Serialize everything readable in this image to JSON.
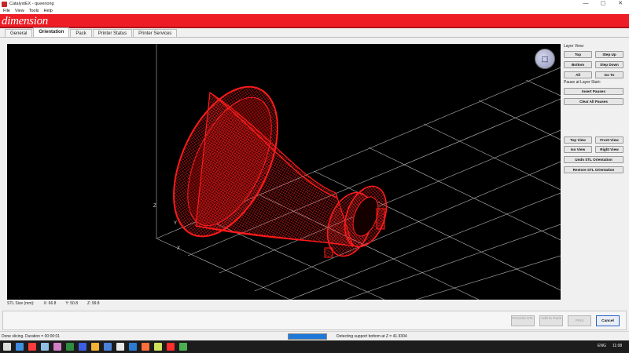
{
  "window": {
    "title": "CatalystEX - queenorig",
    "min": "—",
    "max": "▢",
    "close": "✕"
  },
  "menu": [
    "File",
    "View",
    "Tools",
    "Help"
  ],
  "brand": {
    "logo_text": "dimension",
    "color": "#ee1c25"
  },
  "tabs": [
    {
      "label": "General",
      "active": false
    },
    {
      "label": "Orientation",
      "active": true
    },
    {
      "label": "Pack",
      "active": false
    },
    {
      "label": "Printer Status",
      "active": false
    },
    {
      "label": "Printer Services",
      "active": false
    }
  ],
  "viewport": {
    "background": "#000000",
    "model_color": "#ff1a1a",
    "axis_labels": {
      "z": "Z",
      "y": "Y",
      "x": "X"
    },
    "nav_cube_icon": "view-cube-icon"
  },
  "layer_view": {
    "heading": "Layer View:",
    "top": "Top",
    "step_up": "Step Up",
    "bottom": "Bottom",
    "step_down": "Step Down",
    "all": "All",
    "go_to": "Go To",
    "pause_heading": "Pause at Layer Start:",
    "insert_pauses": "Insert Pauses",
    "clear_all_pauses": "Clear All Pauses"
  },
  "view_buttons": {
    "top_view": "Top View",
    "front_view": "Front View",
    "iso_view": "Iso View",
    "right_view": "Right View",
    "undo_stl": "Undo STL Orientation",
    "restore_stl": "Restore STL Orientation"
  },
  "stl_size": {
    "label": "STL Size (mm):",
    "x": "X: 66.8",
    "y": "Y: 50.8",
    "z": "Z: 99.8"
  },
  "actions": {
    "process_stl": "Process STL",
    "add_to_pack": "Add to Pack",
    "print": "Print",
    "cancel": "Cancel"
  },
  "status": {
    "left": "Done slicing. Duration = 00:00:01",
    "progress": 1.0,
    "message": "Detecting support bottom at Z = 41.9304"
  },
  "taskbar": {
    "language": "ENG",
    "time": "11:08"
  }
}
